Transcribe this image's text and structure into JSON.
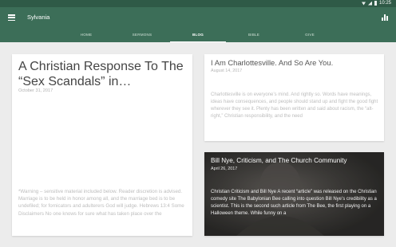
{
  "status": {
    "time": "10:25"
  },
  "app": {
    "title": "Sylvania"
  },
  "tabs": [
    {
      "label": "HOME"
    },
    {
      "label": "SERMONS"
    },
    {
      "label": "BLOG"
    },
    {
      "label": "BIBLE"
    },
    {
      "label": "GIVE"
    }
  ],
  "active_tab": "BLOG",
  "posts": [
    {
      "title": "A Christian Response To The “Sex Scandals” in…",
      "date": "October 31, 2017",
      "excerpt": "*Warning – sensitive material included below. Reader discretion is advised. Marriage is to be held in honor among all, and the marriage bed is to be undefiled; for fornicators and adulterers God will judge. Hebrews 13:4 Some Disclaimers No one knows for sure what has taken place over the"
    },
    {
      "title": "I Am Charlottesville. And So Are You.",
      "date": "August 14, 2017",
      "excerpt": "Charlottesville is on everyone’s mind. And rightly so. Words have meanings, ideas have consequences, and people should stand up and fight the good fight wherever they see it. Plenty has been written and said about racism, the “alt-right,” Christian responsibility, and the need"
    },
    {
      "title": "Bill Nye, Criticism, and The Church Community",
      "date": "April 26, 2017",
      "excerpt": "Christian Criticism and Bill Nye A recent “article” was released on the Christian comedy site The Babylonian Bee calling into question Bill Nye’s credibility as a scientist. This is the second such article from The Bee, the first playing on a Halloween theme. While funny on a"
    }
  ],
  "colors": {
    "status_bar": "#2f5a47",
    "app_bar": "#3c6e58",
    "background": "#ececec"
  }
}
